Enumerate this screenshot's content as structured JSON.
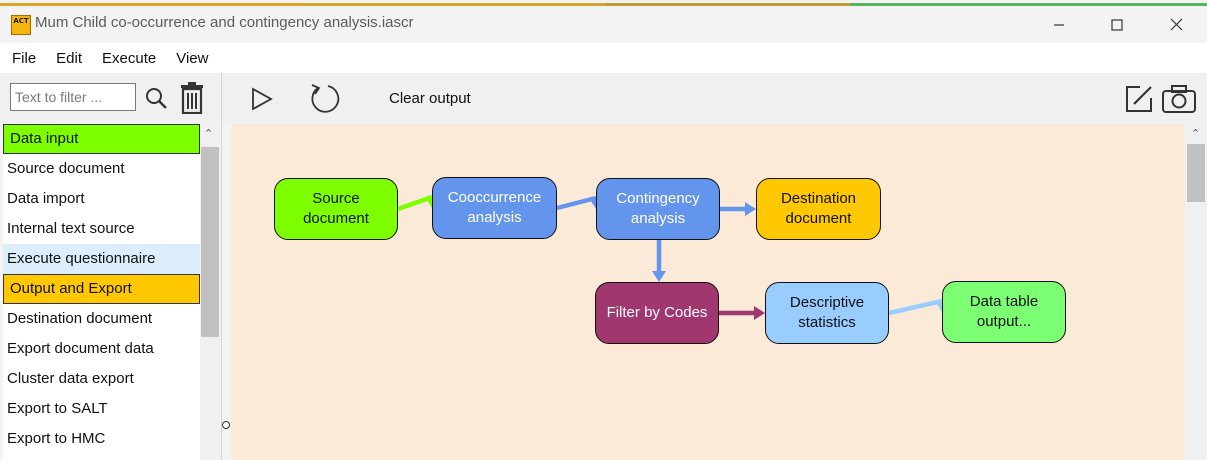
{
  "window": {
    "title": "Mum Child co-occurrence and contingency analysis.iascr",
    "app_icon_text": "ACT",
    "accent_colors": [
      "#d8a62a",
      "#d4a32a",
      "#c09a39",
      "#58b45e"
    ]
  },
  "menu": {
    "items": [
      "File",
      "Edit",
      "Execute",
      "View"
    ]
  },
  "toolbar": {
    "filter_placeholder": "Text to filter ...",
    "clear_output_label": "Clear output"
  },
  "sidebar": {
    "items": [
      {
        "label": "Data input",
        "kind": "category",
        "color": "#7dff00"
      },
      {
        "label": "Source document",
        "kind": "item"
      },
      {
        "label": "Data import",
        "kind": "item"
      },
      {
        "label": "Internal text source",
        "kind": "item"
      },
      {
        "label": "Execute questionnaire",
        "kind": "item",
        "hovered": true
      },
      {
        "label": "Output and Export",
        "kind": "category",
        "color": "#ffc800"
      },
      {
        "label": "Destination document",
        "kind": "item"
      },
      {
        "label": "Export document data",
        "kind": "item"
      },
      {
        "label": "Cluster data export",
        "kind": "item"
      },
      {
        "label": "Export to SALT",
        "kind": "item"
      },
      {
        "label": "Export to HMC",
        "kind": "item"
      }
    ]
  },
  "workflow": {
    "canvas_color": "#fbead7",
    "nodes": [
      {
        "id": "source",
        "label": "Source\ndocument",
        "color": "#7dff00",
        "text_color": "#111111"
      },
      {
        "id": "cooc",
        "label": "Cooccurrence\nanalysis",
        "color": "#6495ed",
        "text_color": "#ffffff"
      },
      {
        "id": "cont",
        "label": "Contingency\nanalysis",
        "color": "#6495ed",
        "text_color": "#ffffff"
      },
      {
        "id": "dest",
        "label": "Destination\ndocument",
        "color": "#ffc800",
        "text_color": "#111111"
      },
      {
        "id": "filter",
        "label": "Filter by Codes",
        "color": "#a0376e",
        "text_color": "#ffffff"
      },
      {
        "id": "desc",
        "label": "Descriptive\nstatistics",
        "color": "#99ccff",
        "text_color": "#111111"
      },
      {
        "id": "table",
        "label": "Data table\noutput...",
        "color": "#7dff73",
        "text_color": "#111111"
      }
    ],
    "edges": [
      {
        "from": "source",
        "to": "cooc",
        "color": "#7dff00"
      },
      {
        "from": "cooc",
        "to": "cont",
        "color": "#6495ed"
      },
      {
        "from": "cont",
        "to": "dest",
        "color": "#6495ed"
      },
      {
        "from": "cont",
        "to": "filter",
        "color": "#6495ed"
      },
      {
        "from": "filter",
        "to": "desc",
        "color": "#a0376e"
      },
      {
        "from": "desc",
        "to": "table",
        "color": "#99ccff"
      }
    ]
  }
}
